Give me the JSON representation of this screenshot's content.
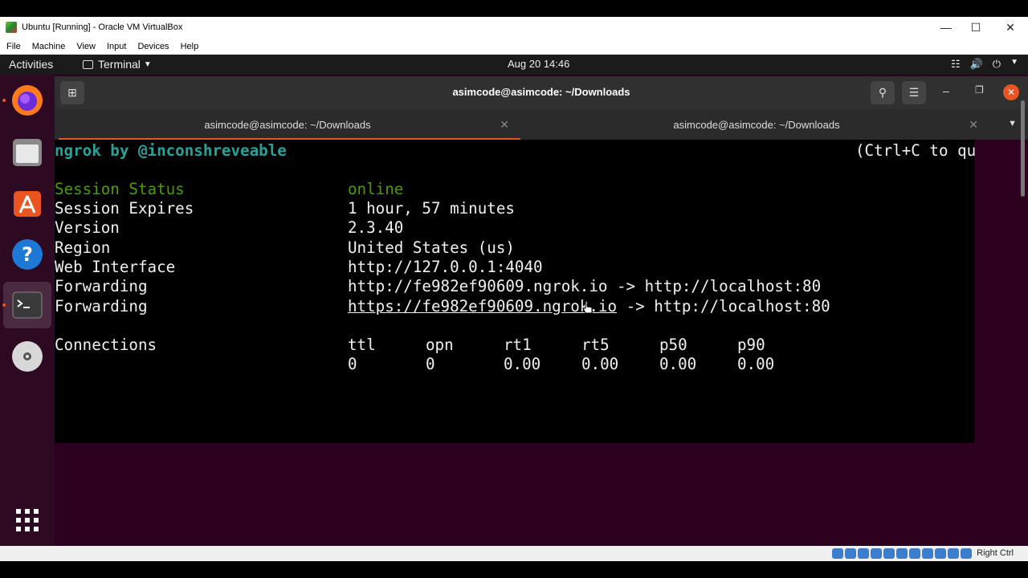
{
  "host": {
    "window_title": "Ubuntu [Running] - Oracle VM VirtualBox",
    "menu": [
      "File",
      "Machine",
      "View",
      "Input",
      "Devices",
      "Help"
    ],
    "status_host_key": "Right Ctrl"
  },
  "topbar": {
    "activities": "Activities",
    "app_menu": "Terminal",
    "clock": "Aug 20  14:46"
  },
  "dock": {
    "items": [
      "firefox-icon",
      "files-icon",
      "app-store-icon",
      "help-icon",
      "terminal-icon",
      "dvd-icon",
      "show-apps-icon"
    ]
  },
  "terminal": {
    "title": "asimcode@asimcode: ~/Downloads",
    "tabs": [
      {
        "label": "asimcode@asimcode: ~/Downloads"
      },
      {
        "label": "asimcode@asimcode: ~/Downloads"
      }
    ],
    "banner_left": "ngrok by @inconshreveable",
    "banner_right": "(Ctrl+C to qu",
    "rows": [
      {
        "label": "Session Status",
        "value": "online"
      },
      {
        "label": "Session Expires",
        "value": "1 hour, 57 minutes"
      },
      {
        "label": "Version",
        "value": "2.3.40"
      },
      {
        "label": "Region",
        "value": "United States (us)"
      },
      {
        "label": "Web Interface",
        "value": "http://127.0.0.1:4040"
      },
      {
        "label": "Forwarding",
        "value": "http://fe982ef90609.ngrok.io -> http://localhost:80"
      },
      {
        "label": "Forwarding",
        "value_link": "https://fe982ef90609.ngrok.io",
        "value_rest": " -> http://localhost:80"
      }
    ],
    "connections": {
      "label": "Connections",
      "headers": [
        "ttl",
        "opn",
        "rt1",
        "rt5",
        "p50",
        "p90"
      ],
      "values": [
        "0",
        "0",
        "0.00",
        "0.00",
        "0.00",
        "0.00"
      ]
    }
  },
  "colors": {
    "ubuntu_orange": "#e95420",
    "desktop_bg": "#2c001e",
    "teal_text": "#2aa198",
    "green_text": "#4e9a06"
  }
}
